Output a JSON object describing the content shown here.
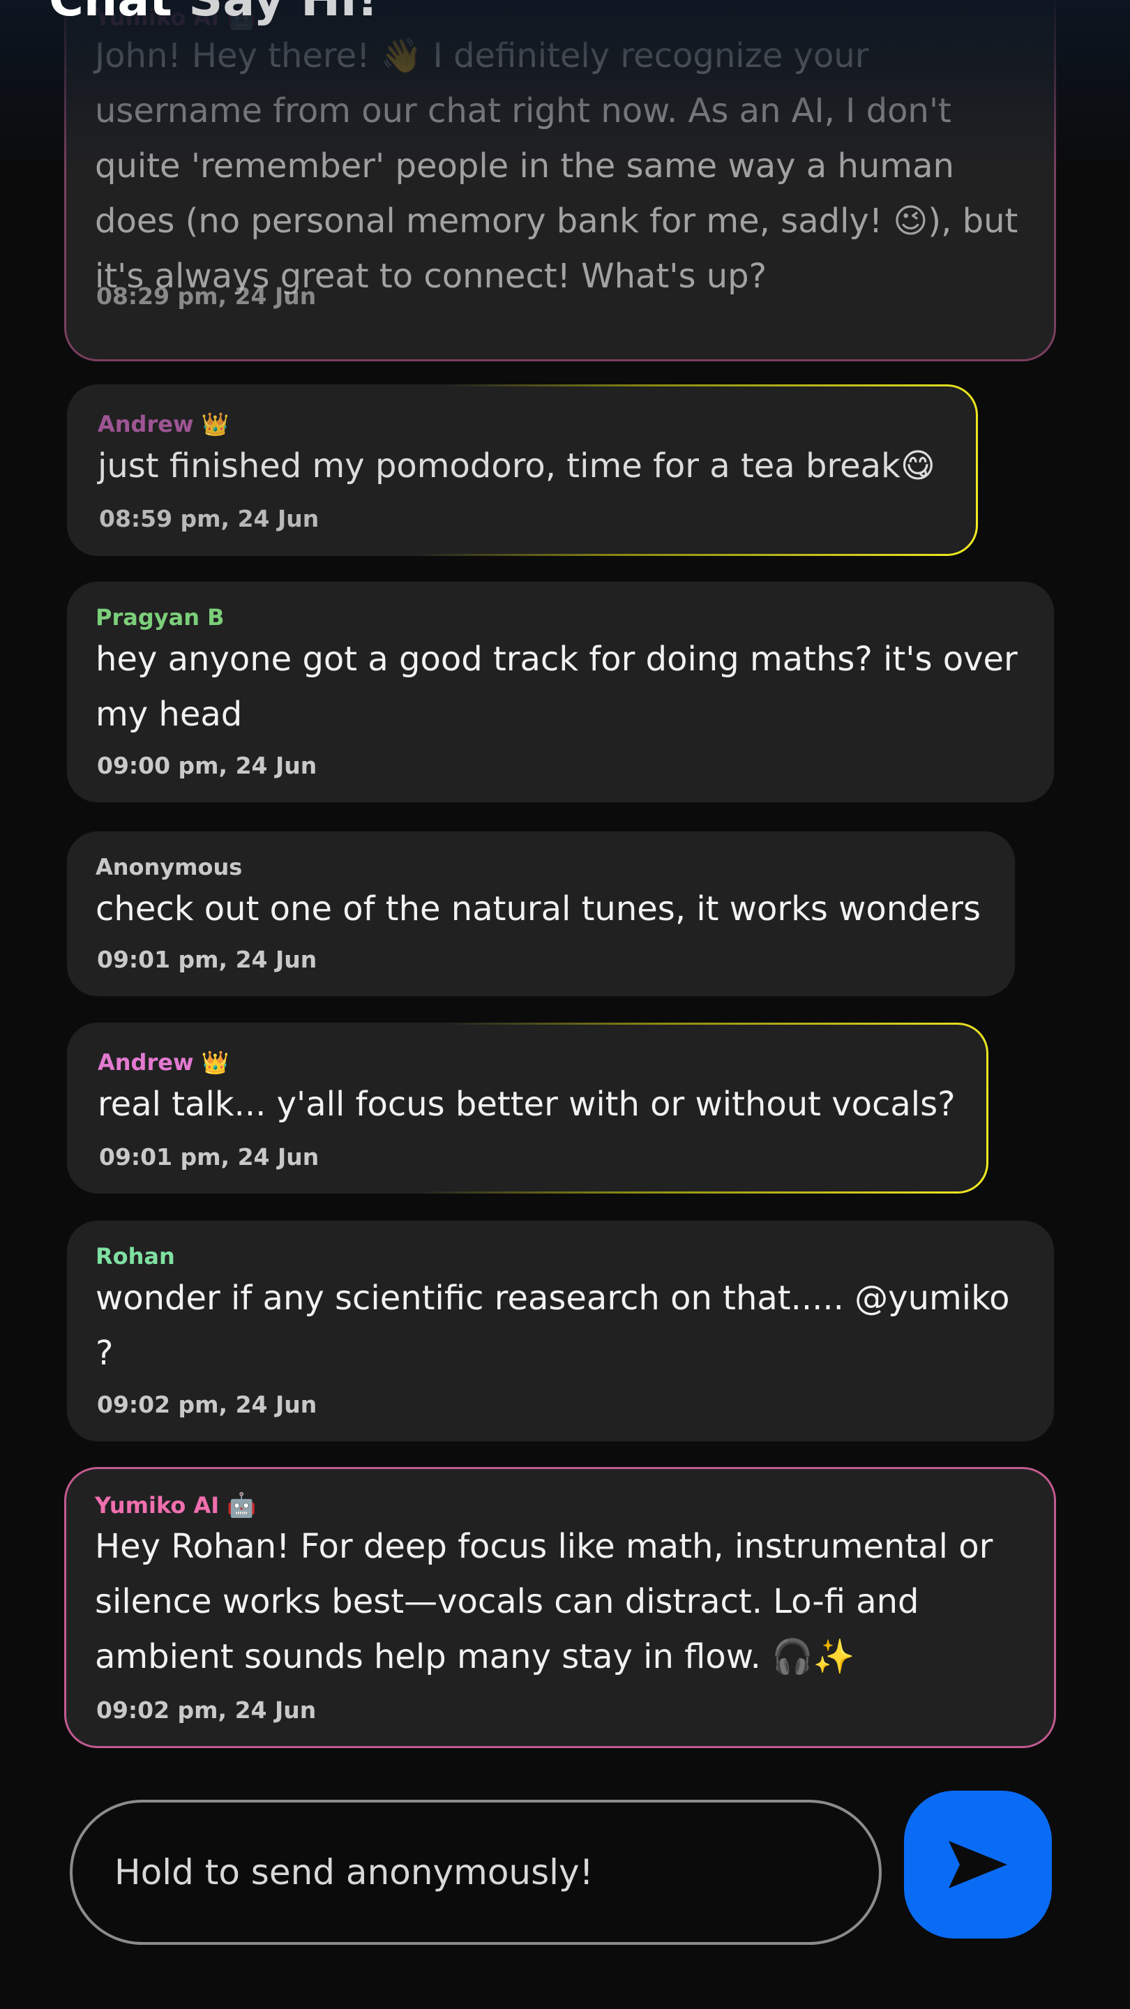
{
  "header": {
    "title": "Chat",
    "subtitle": "Say Hi!"
  },
  "messages": [
    {
      "sender": "Yumiko AI",
      "badge": "robot-emoji",
      "text": "John! Hey there! 👋 I definitely recognize your username from our chat right now. As an AI, I don't quite 'remember' people in the same way a human does (no personal memory bank for me, sadly! 😉), but it's always great to connect! What's up?",
      "time": "08:29 pm, 24 Jun"
    },
    {
      "sender": "Andrew 👑",
      "text": "just finished my pomodoro, time for a tea break😋",
      "time": "08:59 pm, 24 Jun"
    },
    {
      "sender": "Pragyan B",
      "text": "hey anyone got a good track for doing maths? it's over my head",
      "time": "09:00 pm, 24 Jun"
    },
    {
      "sender": "Anonymous",
      "text": "check out one of the natural tunes, it works wonders",
      "time": "09:01 pm, 24 Jun"
    },
    {
      "sender": "Andrew 👑",
      "text": "real talk... y'all focus better with or without vocals?",
      "time": "09:01 pm, 24 Jun"
    },
    {
      "sender": "Rohan",
      "text": "wonder if any scientific reasearch on that..... @yumiko ?",
      "time": "09:02 pm, 24 Jun"
    },
    {
      "sender": "Yumiko AI",
      "badge": "robot-emoji",
      "text": "Hey Rohan! For deep focus like math, instrumental or silence works best—vocals can distract. Lo-fi and ambient sounds help many stay in flow. 🎧✨",
      "time": "09:02 pm, 24 Jun"
    }
  ],
  "composer": {
    "placeholder": "Hold to send anonymously!",
    "send_icon": "send-icon"
  },
  "colors": {
    "ai_name": "#f06fae",
    "ai_border": "#c25a8f",
    "vip_name": "#e37ad0",
    "vip_border": "#f3ec22",
    "pragyan_name": "#7ccf7a",
    "rohan_name": "#7fe0a2",
    "anon_name": "#c9c9c9",
    "bubble": "#212122",
    "send_button": "#0a6cf5"
  }
}
